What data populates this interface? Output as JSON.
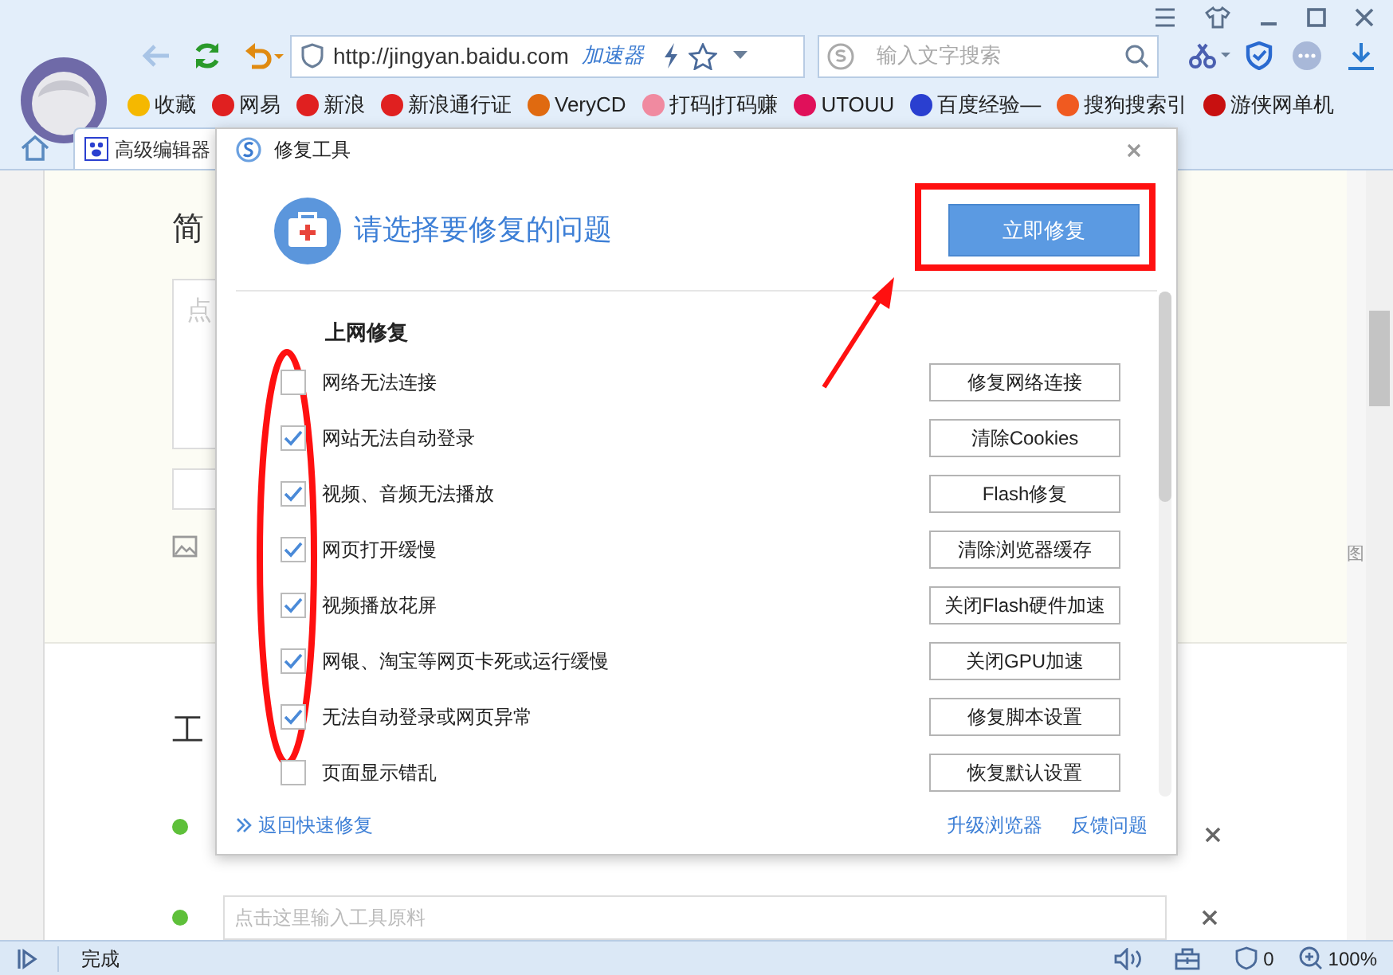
{
  "browser": {
    "address": "http://jingyan.baidu.com",
    "accelerator": "加速器",
    "search": {
      "placeholder": "输入文字搜索"
    },
    "bookmarks": [
      {
        "label": "收藏",
        "color": "#f5b800"
      },
      {
        "label": "网易",
        "color": "#e02020"
      },
      {
        "label": "新浪",
        "color": "#e02020"
      },
      {
        "label": "新浪通行证",
        "color": "#e02020"
      },
      {
        "label": "VeryCD",
        "color": "#e06a10"
      },
      {
        "label": "打码|打码赚",
        "color": "#f08aa0"
      },
      {
        "label": "UTOUU",
        "color": "#e0105a"
      },
      {
        "label": "百度经验—",
        "color": "#2a3fd0"
      },
      {
        "label": "搜狗搜索引",
        "color": "#f05a20"
      },
      {
        "label": "游侠网单机",
        "color": "#c81010"
      }
    ],
    "tab": {
      "label": "高级编辑器"
    }
  },
  "page": {
    "heading_1": "简",
    "placeholder_1": "点",
    "heading_2": "工",
    "side_label": "图",
    "material_placeholder": "点击这里输入工具原料"
  },
  "dialog": {
    "title": "修复工具",
    "heading": "请选择要修复的问题",
    "primary_button": "立即修复",
    "section": "上网修复",
    "items": [
      {
        "label": "网络无法连接",
        "checked": false,
        "button": "修复网络连接"
      },
      {
        "label": "网站无法自动登录",
        "checked": true,
        "button": "清除Cookies"
      },
      {
        "label": "视频、音频无法播放",
        "checked": true,
        "button": "Flash修复"
      },
      {
        "label": "网页打开缓慢",
        "checked": true,
        "button": "清除浏览器缓存"
      },
      {
        "label": "视频播放花屏",
        "checked": true,
        "button": "关闭Flash硬件加速"
      },
      {
        "label": "网银、淘宝等网页卡死或运行缓慢",
        "checked": true,
        "button": "关闭GPU加速"
      },
      {
        "label": "无法自动登录或网页异常",
        "checked": true,
        "button": "修复脚本设置"
      },
      {
        "label": "页面显示错乱",
        "checked": false,
        "button": "恢复默认设置"
      }
    ],
    "back_link": "返回快速修复",
    "links": [
      "升级浏览器",
      "反馈问题"
    ]
  },
  "status_bar": {
    "status": "完成",
    "blocked": "0",
    "zoom": "100%"
  }
}
